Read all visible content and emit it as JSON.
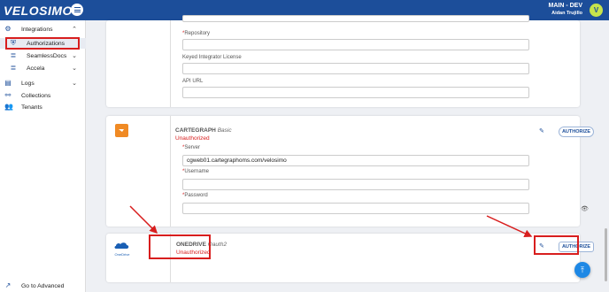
{
  "header": {
    "logo": "VELOSIMO",
    "environment": "MAIN - DEV",
    "user_name": "Aidan Trujillo",
    "avatar_initial": "V"
  },
  "sidebar": {
    "integrations": "Integrations",
    "authorizations": "Authorizations",
    "seamlessdocs": "SeamlessDocs",
    "accela": "Accela",
    "logs": "Logs",
    "collections": "Collections",
    "tenants": "Tenants",
    "advanced": "Go to Advanced"
  },
  "top_card": {
    "repository_label": "Repository",
    "license_label": "Keyed Integrator License",
    "api_url_label": "API URL"
  },
  "cartegraph": {
    "name": "CARTEGRAPH",
    "auth_type": "Basic",
    "status": "Unauthorized",
    "authorize_label": "AUTHORIZE",
    "server_label": "Server",
    "server_value": "cgweb01.cartegraphoms.com/velosimo",
    "username_label": "Username",
    "password_label": "Password"
  },
  "onedrive": {
    "logo_text": "OneDrive",
    "name": "ONEDRIVE",
    "auth_type": "Oauth2",
    "status": "Unauthorized",
    "authorize_label": "AUTHORIZE"
  },
  "colors": {
    "brand": "#1c4e9a",
    "error": "#d81e1e",
    "highlight": "#d81e1e",
    "cartegraph_orange": "#f08a24",
    "fab": "#1e88e5"
  },
  "icons": {
    "menu": "hamburger-icon",
    "integrations": "gear-icon",
    "authorizations": "shield-icon",
    "logs": "log-icon",
    "collections": "link-icon",
    "tenants": "people-icon",
    "advanced": "external-link-icon",
    "edit": "pencil-icon",
    "eye": "eye-icon",
    "scroll_top": "arrow-up-icon"
  }
}
